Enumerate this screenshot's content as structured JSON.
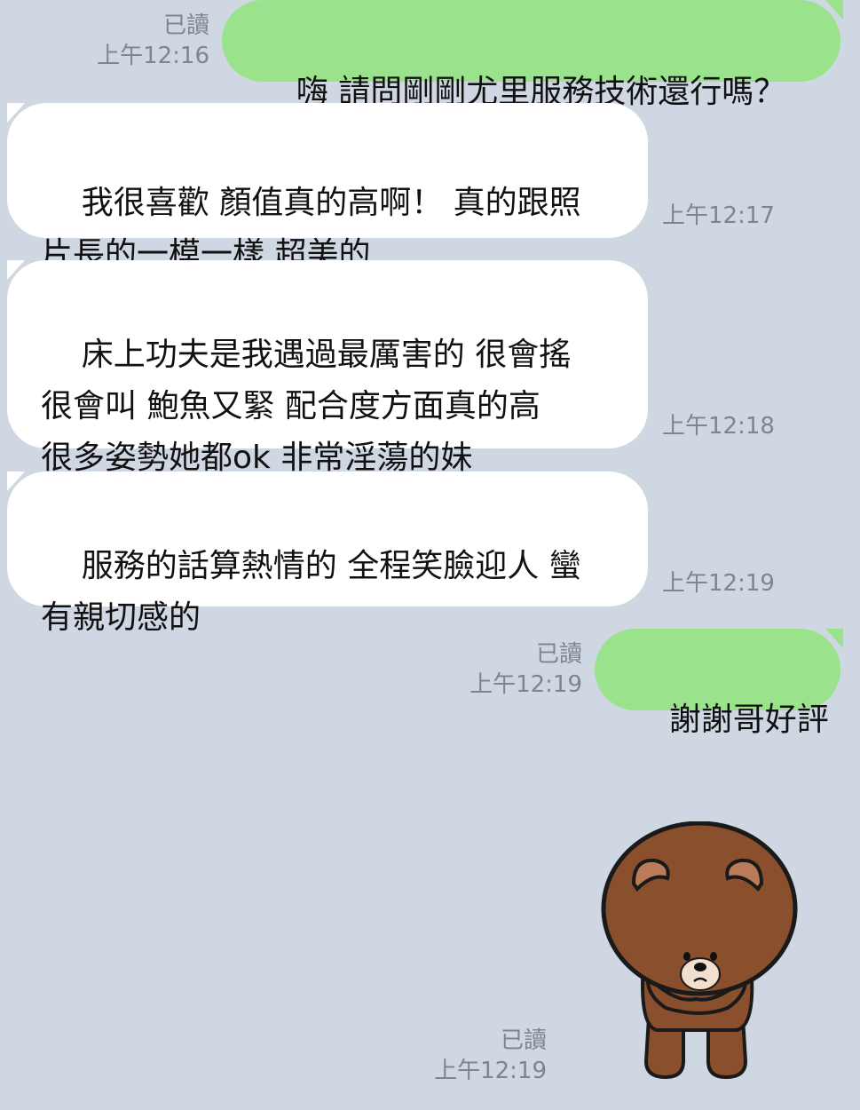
{
  "messages": [
    {
      "direction": "out",
      "text": "嗨 請問剛剛尤里服務技術還行嗎？",
      "read": "已讀",
      "time": "上午12:16"
    },
    {
      "direction": "in",
      "text": "我很喜歡 顏值真的高啊！ 真的跟照\n片長的一模一樣 超美的",
      "time": "上午12:17"
    },
    {
      "direction": "in",
      "text": "床上功夫是我遇過最厲害的 很會搖\n很會叫 鮑魚又緊 配合度方面真的高\n很多姿勢她都ok 非常淫蕩的妹",
      "time": "上午12:18"
    },
    {
      "direction": "in",
      "text": "服務的話算熱情的 全程笑臉迎人 蠻\n有親切感的",
      "time": "上午12:19"
    },
    {
      "direction": "out",
      "text": "謝謝哥好評",
      "read": "已讀",
      "time": "上午12:19"
    }
  ],
  "sticker": {
    "name": "brown-bear-sticker",
    "read": "已讀",
    "time": "上午12:19"
  },
  "colors": {
    "background": "#cfd8e2",
    "outgoing_bubble": "#9be28d",
    "incoming_bubble": "#ffffff",
    "meta_text": "#7c8590",
    "bear_brown": "#8a4f2c"
  }
}
